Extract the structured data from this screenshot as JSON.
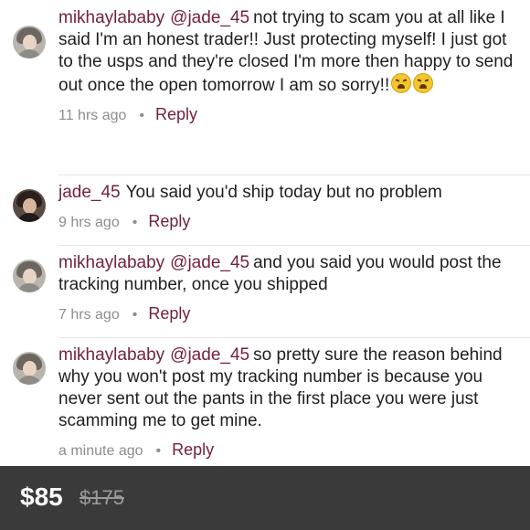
{
  "comments": [
    {
      "username": "mikhaylababy",
      "mention": "@jade_45",
      "text": "not trying to scam you at all like I said I'm an honest trader!! Just protecting myself! I just got to the usps and they're closed I'm more then happy to send out once the open tomorrow I am so sorry!!",
      "emojis": [
        "weary-face-emoji",
        "weary-face-emoji"
      ],
      "time": "11 hrs ago",
      "reply_label": "Reply"
    },
    {
      "username": "jade_45",
      "mention": "",
      "text": "You said you'd ship today but no problem",
      "time": "9 hrs ago",
      "reply_label": "Reply"
    },
    {
      "username": "mikhaylababy",
      "mention": "@jade_45",
      "text": "and you said you would post the tracking number, once you shipped",
      "time": "7 hrs ago",
      "reply_label": "Reply"
    },
    {
      "username": "mikhaylababy",
      "mention": "@jade_45",
      "text": "so pretty sure the reason behind why you won't post my tracking number is because you never sent out the pants in the first place you were just scamming me to get mine.",
      "time": "a minute ago",
      "reply_label": "Reply"
    }
  ],
  "price_bar": {
    "price": "$85",
    "original_price": "$175"
  },
  "colors": {
    "username": "#73213f",
    "price_bar_bg": "#3a3a3a"
  }
}
